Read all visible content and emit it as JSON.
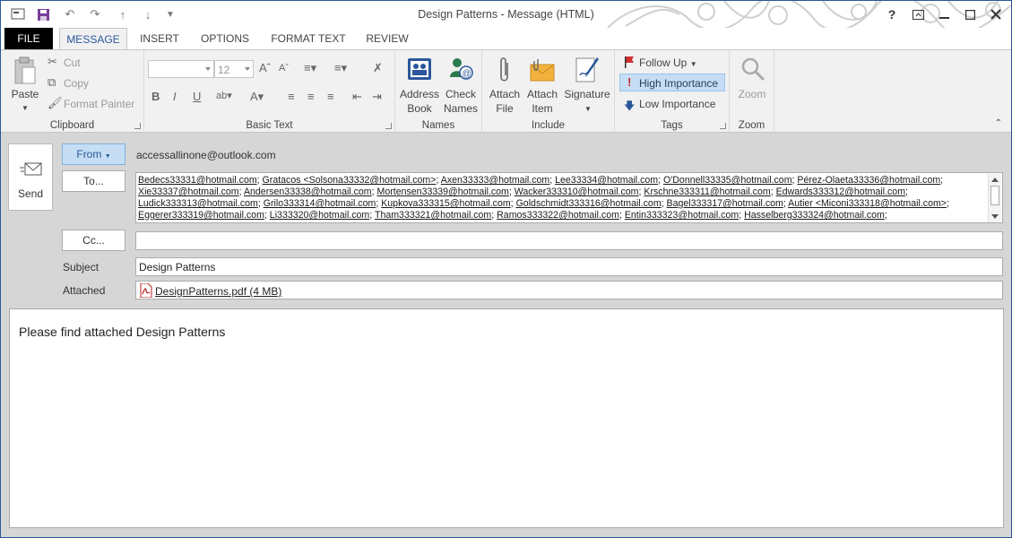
{
  "window": {
    "title": "Design Patterns - Message (HTML)"
  },
  "tabs": [
    "FILE",
    "MESSAGE",
    "INSERT",
    "OPTIONS",
    "FORMAT TEXT",
    "REVIEW"
  ],
  "ribbon": {
    "clipboard": {
      "paste": "Paste",
      "cut": "Cut",
      "copy": "Copy",
      "format_painter": "Format Painter",
      "label": "Clipboard"
    },
    "basic_text": {
      "font_size": "12",
      "bold": "B",
      "italic": "I",
      "underline": "U",
      "label": "Basic Text"
    },
    "names": {
      "address_book_1": "Address",
      "address_book_2": "Book",
      "check_names_1": "Check",
      "check_names_2": "Names",
      "label": "Names"
    },
    "include": {
      "attach_file_1": "Attach",
      "attach_file_2": "File",
      "attach_item_1": "Attach",
      "attach_item_2": "Item",
      "signature": "Signature",
      "label": "Include"
    },
    "tags": {
      "follow_up": "Follow Up",
      "high": "High Importance",
      "low": "Low Importance",
      "label": "Tags"
    },
    "zoom": {
      "zoom": "Zoom",
      "label": "Zoom"
    }
  },
  "compose": {
    "send": "Send",
    "from_button": "From",
    "from_value": "accessallinone@outlook.com",
    "to_button": "To...",
    "to_recipients": [
      "Bedecs33331@hotmail.com",
      "Gratacos <Solsona33332@hotmail.com>",
      "Axen33333@hotmail.com",
      "Lee33334@hotmail.com",
      "O'Donnell33335@hotmail.com",
      "Pérez-Olaeta33336@hotmail.com",
      "Xie33337@hotmail.com",
      "Andersen33338@hotmail.com",
      "Mortensen33339@hotmail.com",
      "Wacker333310@hotmail.com",
      "Krschne333311@hotmail.com",
      "Edwards333312@hotmail.com",
      "Ludick333313@hotmail.com",
      "Grilo333314@hotmail.com",
      "Kupkova333315@hotmail.com",
      "Goldschmidt333316@hotmail.com",
      "Bagel333317@hotmail.com",
      "Autier <Miconi333318@hotmail.com>",
      "Eggerer333319@hotmail.com",
      "Li333320@hotmail.com",
      "Tham333321@hotmail.com",
      "Ramos333322@hotmail.com",
      "Entin333323@hotmail.com",
      "Hasselberg333324@hotmail.com"
    ],
    "cc_button": "Cc...",
    "cc_value": "",
    "subject_label": "Subject",
    "subject_value": "Design Patterns",
    "attached_label": "Attached",
    "attachment": "DesignPatterns.pdf (4 MB)",
    "body": "Please find attached Design Patterns"
  },
  "colors": {
    "accent": "#2b579a",
    "high_importance_bg": "#c5def5",
    "from_button_bg": "#c5def5"
  }
}
